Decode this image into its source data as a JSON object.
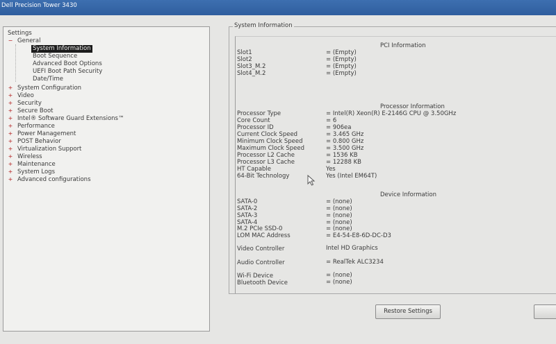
{
  "window": {
    "title": "Dell Precision Tower 3430"
  },
  "tree": {
    "root": "Settings",
    "general": "General",
    "general_children": [
      "System Information",
      "Boot Sequence",
      "Advanced Boot Options",
      "UEFI Boot Path Security",
      "Date/Time"
    ],
    "categories": [
      "System Configuration",
      "Video",
      "Security",
      "Secure Boot",
      "Intel® Software Guard Extensions™",
      "Performance",
      "Power Management",
      "POST Behavior",
      "Virtualization Support",
      "Wireless",
      "Maintenance",
      "System Logs",
      "Advanced configurations"
    ],
    "expander_minus": "−",
    "expander_plus": "+"
  },
  "panel": {
    "title": "System Information",
    "pci": {
      "heading": "PCI Information",
      "rows": [
        {
          "label": "Slot1",
          "value": "= (Empty)"
        },
        {
          "label": "Slot2",
          "value": "= (Empty)"
        },
        {
          "label": "Slot3_M.2",
          "value": "= (Empty)"
        },
        {
          "label": "Slot4_M.2",
          "value": "= (Empty)"
        }
      ]
    },
    "processor": {
      "heading": "Processor Information",
      "rows": [
        {
          "label": "Processor Type",
          "value": "= Intel(R) Xeon(R) E-2146G CPU @ 3.50GHz"
        },
        {
          "label": "Core Count",
          "value": "= 6"
        },
        {
          "label": "Processor ID",
          "value": "= 906ea"
        },
        {
          "label": "Current Clock Speed",
          "value": "= 3.465 GHz"
        },
        {
          "label": "Minimum Clock Speed",
          "value": "= 0.800 GHz"
        },
        {
          "label": "Maximum Clock Speed",
          "value": "= 3.500 GHz"
        },
        {
          "label": "Processor L2 Cache",
          "value": "= 1536 KB"
        },
        {
          "label": "Processor L3 Cache",
          "value": "= 12288 KB"
        },
        {
          "label": "HT Capable",
          "value": "Yes"
        },
        {
          "label": "64-Bit Technology",
          "value": "Yes (Intel EM64T)"
        }
      ]
    },
    "device": {
      "heading": "Device Information",
      "rows": [
        {
          "label": "SATA-0",
          "value": "= (none)"
        },
        {
          "label": "SATA-2",
          "value": "= (none)"
        },
        {
          "label": "SATA-3",
          "value": "= (none)"
        },
        {
          "label": "SATA-4",
          "value": "= (none)"
        },
        {
          "label": "M.2 PCIe SSD-0",
          "value": "= (none)"
        },
        {
          "label": "LOM MAC Address",
          "value": "= E4-54-E8-6D-DC-D3"
        }
      ],
      "video": {
        "label": "Video Controller",
        "value": "Intel HD Graphics"
      },
      "audio": {
        "label": "Audio Controller",
        "value": "= RealTek ALC3234"
      },
      "wireless": [
        {
          "label": "Wi-Fi Device",
          "value": "= (none)"
        },
        {
          "label": "Bluetooth Device",
          "value": "= (none)"
        }
      ]
    }
  },
  "buttons": {
    "restore": "Restore Settings"
  }
}
